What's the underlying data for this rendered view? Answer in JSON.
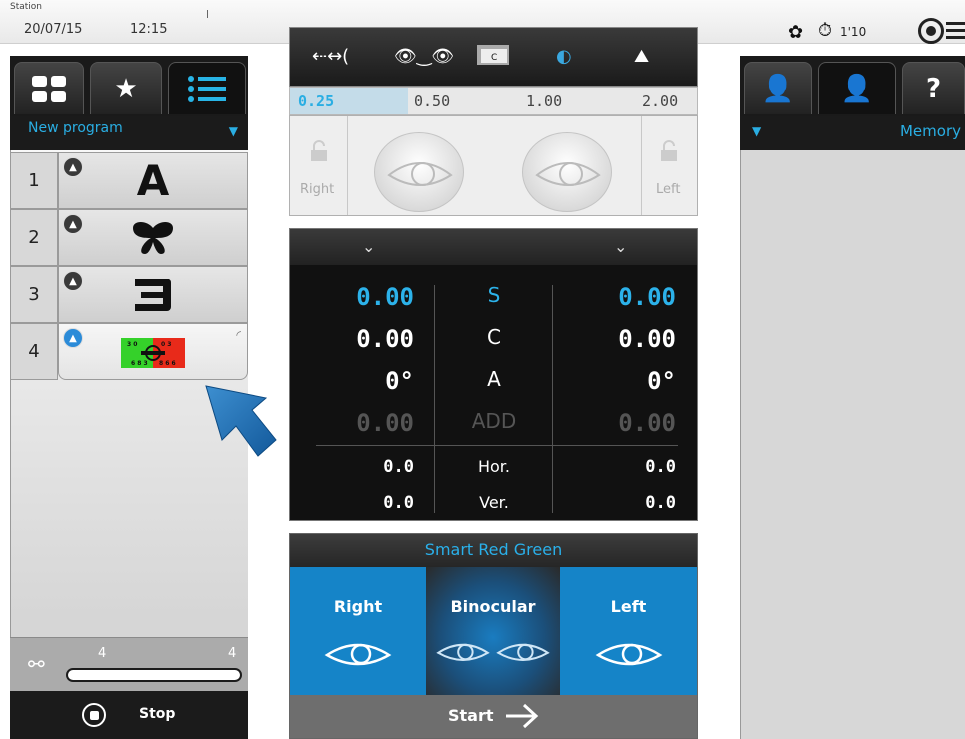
{
  "header": {
    "station_label": "Station",
    "date": "20/07/15",
    "time": "12:15",
    "timer": "1'10"
  },
  "left_panel": {
    "tabs": [
      "grid-view",
      "favorites",
      "list-view"
    ],
    "active_tab": "list-view",
    "program_selector": "New program",
    "rows": [
      {
        "num": "1",
        "target": "A"
      },
      {
        "num": "2",
        "target": "butterfly"
      },
      {
        "num": "3",
        "target": "Ɛ"
      },
      {
        "num": "4",
        "target": "red-green-chart",
        "selected": true
      }
    ],
    "counter": {
      "current": "4",
      "total": "4"
    },
    "stop_label": "Stop"
  },
  "target_toolbar": {
    "icons": [
      "near-distance-icon",
      "eye-convergence-icon",
      "card-c-icon",
      "aperture-icon",
      "landscape-icon"
    ]
  },
  "acuity_scale": {
    "values": [
      "0.25",
      "0.50",
      "1.00",
      "2.00"
    ],
    "selected": "0.25"
  },
  "eyes": {
    "right_label": "Right",
    "left_label": "Left"
  },
  "refraction": {
    "rows": [
      {
        "label": "S",
        "right": "0.00",
        "left": "0.00",
        "highlight": true
      },
      {
        "label": "C",
        "right": "0.00",
        "left": "0.00"
      },
      {
        "label": "A",
        "right": "0°",
        "left": "0°"
      },
      {
        "label": "ADD",
        "right": "0.00",
        "left": "0.00",
        "dim": true
      }
    ],
    "prism": [
      {
        "label": "Hor.",
        "right": "0.0",
        "left": "0.0"
      },
      {
        "label": "Ver.",
        "right": "0.0",
        "left": "0.0"
      }
    ]
  },
  "test": {
    "title": "Smart Red Green",
    "buttons": [
      "Right",
      "Binocular",
      "Left"
    ],
    "start_label": "Start"
  },
  "right_panel": {
    "memory_label": "Memory"
  },
  "colors": {
    "accent": "#2cb2ea",
    "button_blue": "#1584c8",
    "dark": "#111111"
  }
}
